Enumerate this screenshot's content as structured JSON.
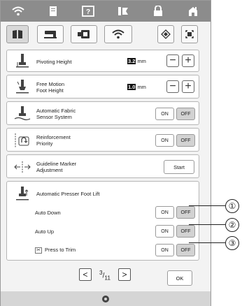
{
  "topbar": {
    "tabs": [
      {
        "icon": "wifi-icon"
      },
      {
        "icon": "document-icon"
      },
      {
        "icon": "help-icon",
        "label": "?"
      },
      {
        "icon": "tools-icon"
      },
      {
        "icon": "lock-icon"
      },
      {
        "icon": "home-icon"
      }
    ]
  },
  "categories": [
    {
      "icon": "book-icon",
      "selected": true
    },
    {
      "icon": "sewing-machine-icon",
      "selected": false
    },
    {
      "icon": "embroidery-icon",
      "selected": false
    },
    {
      "icon": "wifi-icon",
      "selected": false
    },
    {
      "icon": "diamond-icon",
      "selected": false
    },
    {
      "icon": "screen-icon",
      "selected": false
    }
  ],
  "settings": {
    "pivoting_height": {
      "label": "Pivoting Height",
      "value": "3.2",
      "unit": "mm",
      "minus": "−",
      "plus": "+"
    },
    "free_motion": {
      "label_1": "Free Motion",
      "label_2": "Foot Height",
      "value": "1.0",
      "unit": "mm",
      "minus": "−",
      "plus": "+"
    },
    "fabric_sensor": {
      "label_1": "Automatic Fabric",
      "label_2": "Sensor System",
      "on": "ON",
      "off": "OFF",
      "state": "OFF"
    },
    "reinforcement": {
      "label_1": "Reinforcement",
      "label_2": "Priority",
      "on": "ON",
      "off": "OFF",
      "state": "OFF"
    },
    "guideline": {
      "label_1": "Guideline Marker",
      "label_2": "Adjustment",
      "button": "Start"
    },
    "auto_lift": {
      "title": "Automatic Presser Foot Lift",
      "auto_down": {
        "label": "Auto Down",
        "on": "ON",
        "off": "OFF",
        "state": "OFF"
      },
      "auto_up": {
        "label": "Auto Up",
        "on": "ON",
        "off": "OFF",
        "state": "OFF"
      },
      "press_to_trim": {
        "label": "Press to Trim",
        "on": "ON",
        "off": "OFF",
        "state": "OFF"
      }
    }
  },
  "pager": {
    "prev": "<",
    "next": ">",
    "current": "3",
    "total": "11",
    "ok": "OK"
  },
  "callouts": [
    "①",
    "②",
    "③"
  ],
  "colors": {
    "topbar": "#8c8c8c",
    "panel": "#f3f3f3",
    "off_selected": "#d2d2d2"
  }
}
